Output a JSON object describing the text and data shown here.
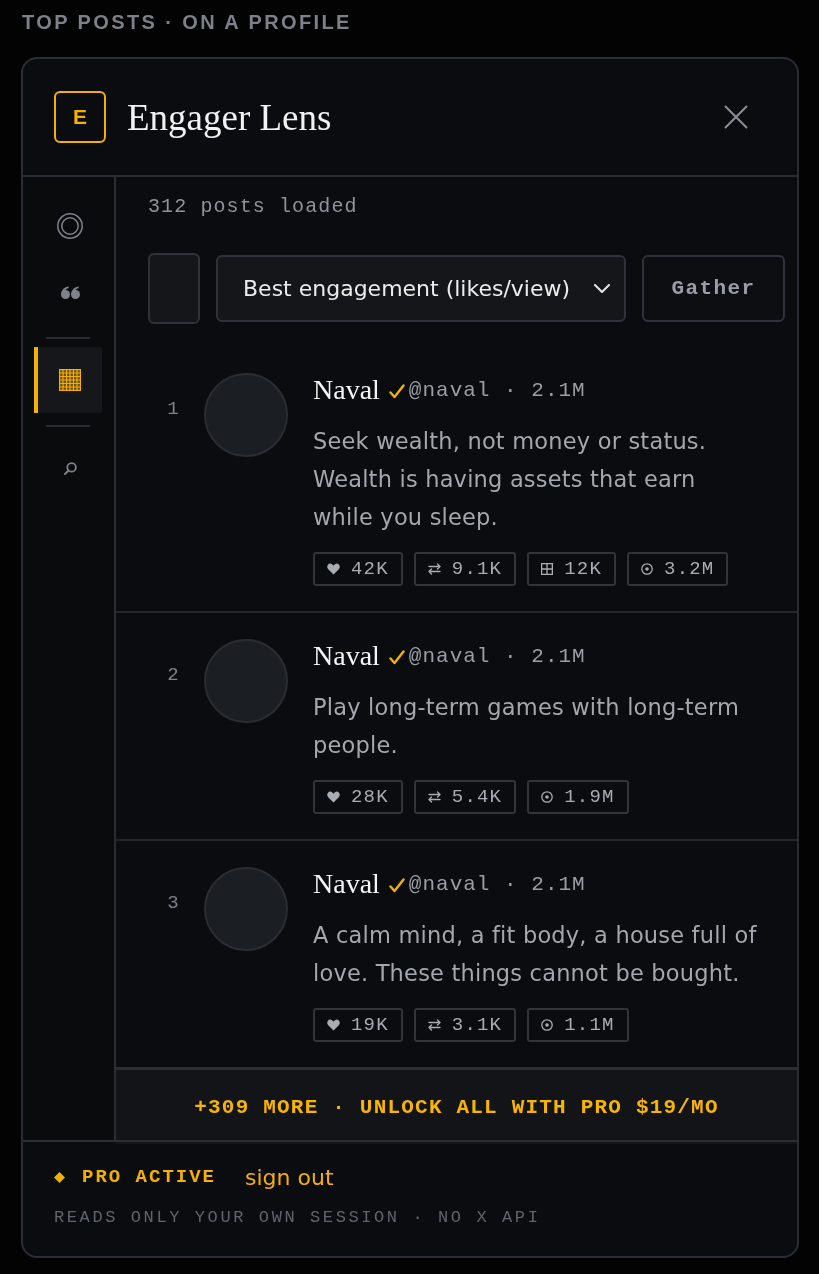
{
  "caption": "TOP POSTS · ON A PROFILE",
  "header": {
    "logo": "E",
    "title": "Engager Lens"
  },
  "sidebar": {
    "items": [
      {
        "kind": "rings",
        "selected": false
      },
      {
        "kind": "quote",
        "selected": false
      },
      {
        "kind": "grid",
        "selected": true
      },
      {
        "kind": "search",
        "selected": false
      }
    ]
  },
  "status": "312 posts loaded",
  "sort": {
    "value": "Best engagement (likes/view)"
  },
  "gather_button": "Gather",
  "posts": [
    {
      "rank": "1",
      "name": "Naval",
      "verified": true,
      "byline": "@naval · 2.1M",
      "text": "Seek wealth, not money or status. Wealth is having assets that earn while you sleep.",
      "stats": [
        {
          "kind": "heart",
          "value": "42K"
        },
        {
          "kind": "arrows",
          "value": "9.1K"
        },
        {
          "kind": "boxplus",
          "value": "12K"
        },
        {
          "kind": "dot",
          "value": "3.2M"
        }
      ]
    },
    {
      "rank": "2",
      "name": "Naval",
      "verified": true,
      "byline": "@naval · 2.1M",
      "text": "Play long-term games with long-term people.",
      "stats": [
        {
          "kind": "heart",
          "value": "28K"
        },
        {
          "kind": "arrows",
          "value": "5.4K"
        },
        {
          "kind": "dot",
          "value": "1.9M"
        }
      ]
    },
    {
      "rank": "3",
      "name": "Naval",
      "verified": true,
      "byline": "@naval · 2.1M",
      "text": "A calm mind, a fit body, a house full of love. These things cannot be bought.",
      "stats": [
        {
          "kind": "heart",
          "value": "19K"
        },
        {
          "kind": "arrows",
          "value": "3.1K"
        },
        {
          "kind": "dot",
          "value": "1.1M"
        }
      ]
    }
  ],
  "upsell": "+309 MORE · UNLOCK ALL WITH PRO $19/MO",
  "footer": {
    "badge": "PRO ACTIVE",
    "link": "sign out",
    "note": "READS ONLY YOUR OWN SESSION · NO X API"
  }
}
